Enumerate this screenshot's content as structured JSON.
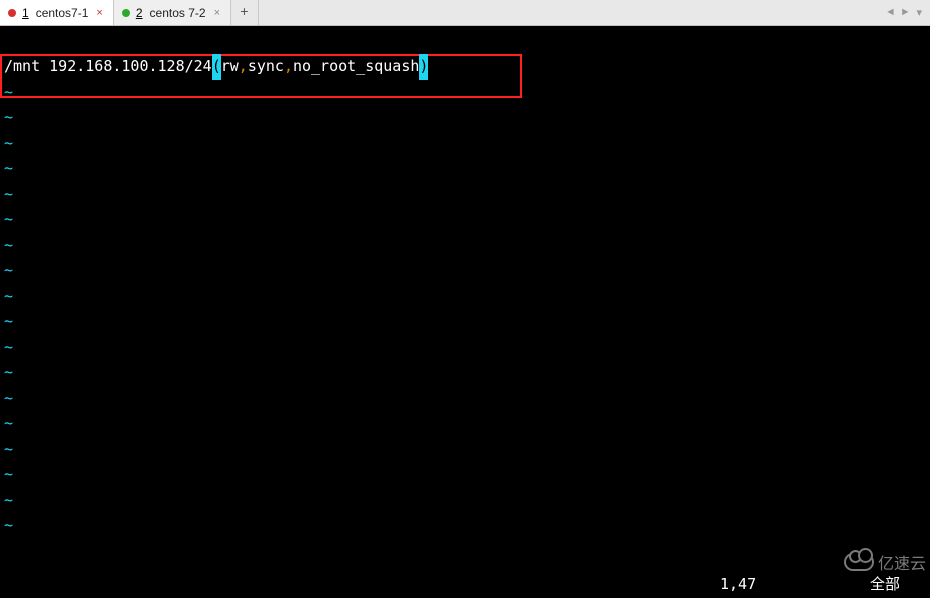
{
  "tabs": [
    {
      "num": "1",
      "label": "centos7-1",
      "status": "red",
      "active": true,
      "close": "×"
    },
    {
      "num": "2",
      "label": "centos 7-2",
      "status": "green",
      "active": false,
      "close": "×"
    }
  ],
  "add_tab": "+",
  "nav": {
    "prev": "◄",
    "next": "►",
    "menu": "▾"
  },
  "editor": {
    "line1": {
      "pre": "/mnt 192.168.100.128/24",
      "paren_open": "(",
      "opt1": "rw",
      "comma1": ",",
      "opt2": "sync",
      "comma2": ",",
      "opt3": "no_root_squash",
      "paren_close": ")"
    },
    "tilde": "~"
  },
  "status": {
    "position": "1,47",
    "scope": "全部"
  },
  "watermark": "亿速云",
  "tilde_count": 18
}
